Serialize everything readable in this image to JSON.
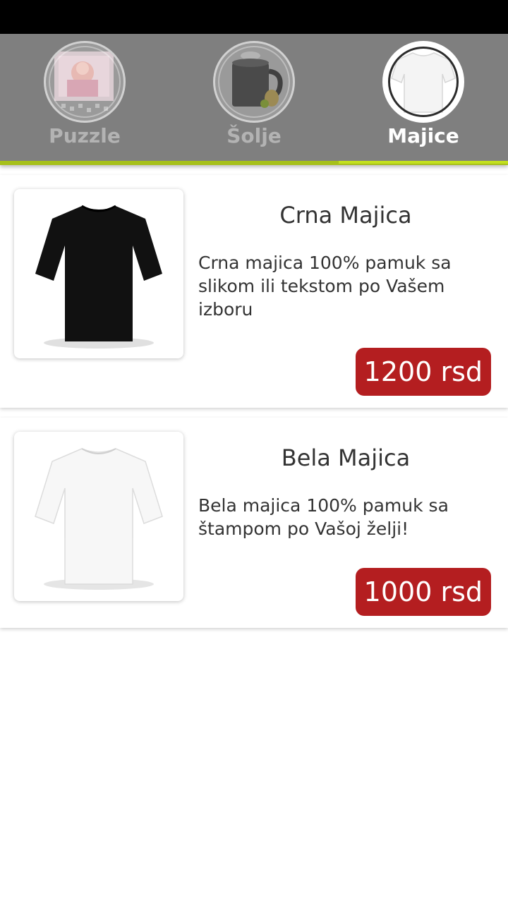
{
  "tabs": [
    {
      "label": "Puzzle",
      "icon": "puzzle-photo-icon",
      "active": false
    },
    {
      "label": "Šolje",
      "icon": "mug-icon",
      "active": false
    },
    {
      "label": "Majice",
      "icon": "tshirt-icon",
      "active": true
    }
  ],
  "products": [
    {
      "title": "Crna Majica",
      "description": "Crna majica 100% pamuk sa slikom ili tekstom po Vašem izboru",
      "price": "1200 rsd",
      "image": "black-tshirt-image"
    },
    {
      "title": "Bela Majica",
      "description": "Bela majica 100% pamuk sa štampom po Vašoj želji!",
      "price": "1000 rsd",
      "image": "white-tshirt-image"
    }
  ],
  "colors": {
    "status_bar": "#000000",
    "tab_bar": "#7f7f7f",
    "accent": "#c3e01f",
    "price_badge": "#b41e20",
    "text": "#333333"
  }
}
